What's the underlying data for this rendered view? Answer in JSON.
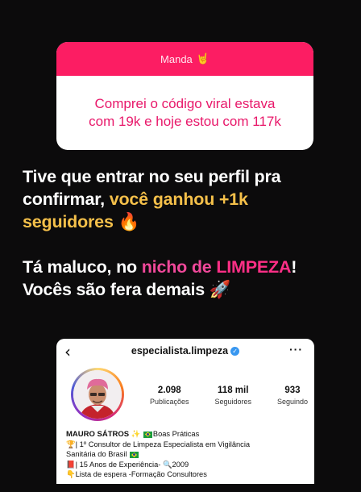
{
  "sticker": {
    "header_label": "Manda",
    "header_emoji": "🤘",
    "question_lines": [
      "Comprei o código viral estava",
      "com 19k e hoje estou com 117k"
    ]
  },
  "caption": {
    "line1": "Tive que entrar no seu perfil pra",
    "line2_white": "confirmar, ",
    "line2_gold": "você ganhou +1k",
    "line3_gold": "seguidores",
    "line3_emoji": "🔥",
    "line4_white": "Tá maluco, no ",
    "line4_pink": "nicho de ",
    "line4_pink_strong": "LIMPEZA",
    "line4_end": "!",
    "line5": "Vocês são fera demais",
    "line5_emoji": "🚀"
  },
  "profile": {
    "back_glyph": "‹",
    "username": "especialista.limpeza",
    "verified_glyph": "✓",
    "more_glyph": "···",
    "stats": [
      {
        "value": "2.098",
        "label": "Publicações"
      },
      {
        "value": "118 mil",
        "label": "Seguidores"
      },
      {
        "value": "933",
        "label": "Seguindo"
      }
    ],
    "bio": {
      "name": "MAURO SÁTROS",
      "name_sparkle": "✨",
      "name_tag": "Boas Práticas",
      "line1_icon": "🏆",
      "line1": "| 1º Consultor de Limpeza Especialista em Vigilância",
      "line2": "Sanitária do Brasil",
      "line3_icon": "📕",
      "line3": "| 15 Anos de Experiência- ",
      "line3_icon2": "🔍",
      "line3_end": "2009",
      "line4_icon": "👇",
      "line4": "Lista de espera -Formação Consultores"
    }
  },
  "colors": {
    "background": "#0c0b0c",
    "sticker_header": "#fc1d63",
    "sticker_text": "#e8186a",
    "gold": "#f5c04a",
    "pink": "#f0489a"
  }
}
